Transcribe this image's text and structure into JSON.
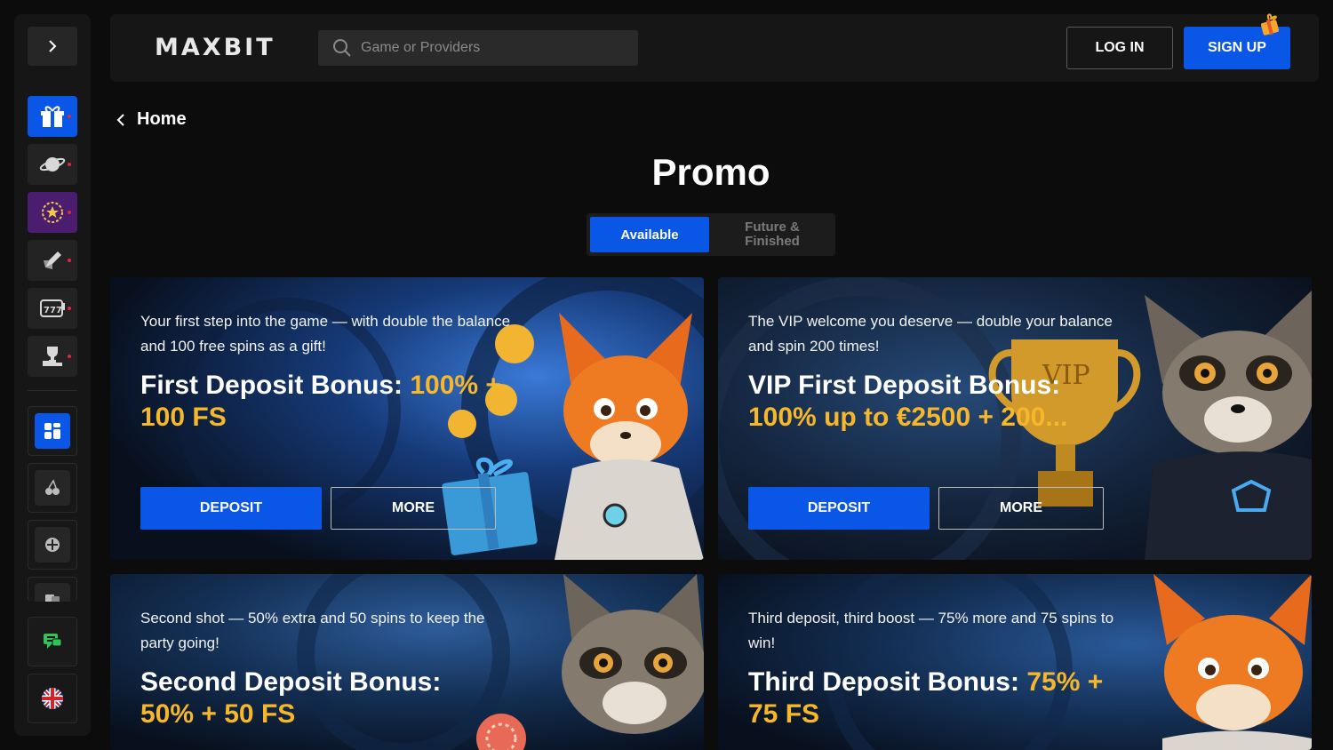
{
  "app": {
    "logo": "MAXBIT"
  },
  "header": {
    "search_placeholder": "Game or Providers",
    "login_label": "LOG IN",
    "signup_label": "SIGN UP"
  },
  "sidebar": {
    "items": [
      {
        "icon": "chevron-right-icon"
      },
      {
        "icon": "gift-icon",
        "active": true
      },
      {
        "icon": "planet-icon"
      },
      {
        "icon": "star-icon"
      },
      {
        "icon": "rocket-icon"
      },
      {
        "icon": "slot-777-icon"
      },
      {
        "icon": "trophy-icon"
      },
      {
        "icon": "grid-icon"
      },
      {
        "icon": "cherry-icon"
      },
      {
        "icon": "ball-icon"
      },
      {
        "icon": "cards-icon"
      },
      {
        "icon": "chat-icon"
      },
      {
        "icon": "uk-flag-icon"
      }
    ]
  },
  "breadcrumb": {
    "label": "Home"
  },
  "page": {
    "title": "Promo"
  },
  "tabs": {
    "available": "Available",
    "future": "Future & Finished"
  },
  "promos": [
    {
      "desc": "Your first step into the game — with double the balance and 100 free spins as a gift!",
      "head_white": "First Deposit Bonus: ",
      "head_yellow": "100% + 100 FS",
      "deposit": "DEPOSIT",
      "more": "MORE"
    },
    {
      "desc": "The VIP welcome you deserve — double your balance and spin 200 times!",
      "head_white": "VIP First Deposit Bonus: ",
      "head_yellow": "100% up to €2500 + 200...",
      "deposit": "DEPOSIT",
      "more": "MORE"
    },
    {
      "desc": "Second shot — 50% extra and 50 spins to keep the party going!",
      "head_white": "Second Deposit Bonus: ",
      "head_yellow": "50% + 50 FS"
    },
    {
      "desc": "Third deposit, third boost — 75% more and 75 spins to win!",
      "head_white": "Third Deposit Bonus: ",
      "head_yellow": "75% + 75 FS"
    }
  ],
  "colors": {
    "accent": "#0a56e6",
    "highlight": "#f6b72a",
    "bg": "#0c0c0c",
    "panel": "#161616"
  }
}
